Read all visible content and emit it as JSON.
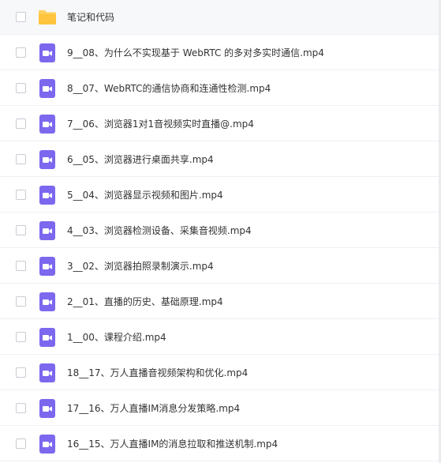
{
  "colors": {
    "folder": "#ffd15b",
    "video_icon": "#7b68ee",
    "text": "#333333",
    "divider": "#eef0f4"
  },
  "files": [
    {
      "name": "笔记和代码",
      "type": "folder",
      "icon": "folder-icon"
    },
    {
      "name": "9__08、为什么不实现基于 WebRTC 的多对多实时通信.mp4",
      "type": "video",
      "icon": "video-icon"
    },
    {
      "name": "8__07、WebRTC的通信协商和连通性检测.mp4",
      "type": "video",
      "icon": "video-icon"
    },
    {
      "name": "7__06、浏览器1对1音视频实时直播@.mp4",
      "type": "video",
      "icon": "video-icon"
    },
    {
      "name": "6__05、浏览器进行桌面共享.mp4",
      "type": "video",
      "icon": "video-icon"
    },
    {
      "name": "5__04、浏览器显示视频和图片.mp4",
      "type": "video",
      "icon": "video-icon"
    },
    {
      "name": "4__03、浏览器检测设备、采集音视频.mp4",
      "type": "video",
      "icon": "video-icon"
    },
    {
      "name": "3__02、浏览器拍照录制演示.mp4",
      "type": "video",
      "icon": "video-icon"
    },
    {
      "name": "2__01、直播的历史、基础原理.mp4",
      "type": "video",
      "icon": "video-icon"
    },
    {
      "name": "1__00、课程介绍.mp4",
      "type": "video",
      "icon": "video-icon"
    },
    {
      "name": "18__17、万人直播音视频架构和优化.mp4",
      "type": "video",
      "icon": "video-icon"
    },
    {
      "name": "17__16、万人直播IM消息分发策略.mp4",
      "type": "video",
      "icon": "video-icon"
    },
    {
      "name": "16__15、万人直播IM的消息拉取和推送机制.mp4",
      "type": "video",
      "icon": "video-icon"
    }
  ]
}
